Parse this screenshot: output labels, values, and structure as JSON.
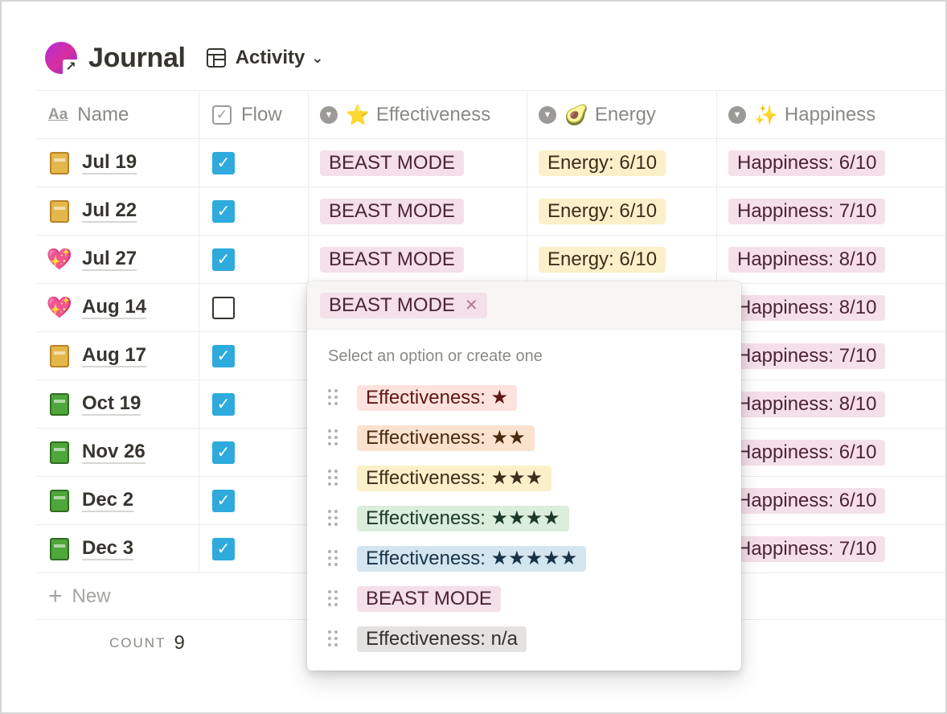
{
  "database": {
    "title": "Journal",
    "view_label": "Activity"
  },
  "columns": [
    {
      "label": "Name",
      "icon": "text-property-icon"
    },
    {
      "label": "Flow",
      "icon": "checkbox-property-icon"
    },
    {
      "label": "Effectiveness",
      "icon": "select-property-icon",
      "emoji": "⭐"
    },
    {
      "label": "Energy",
      "icon": "select-property-icon",
      "emoji": "🥑"
    },
    {
      "label": "Happiness",
      "icon": "select-property-icon",
      "emoji": "✨"
    }
  ],
  "rows": [
    {
      "name": "Jul 19",
      "page_icon": "yellow-notebook-icon",
      "flow": true,
      "effectiveness": "BEAST MODE",
      "energy": "Energy: 6/10",
      "happiness": "Happiness: 6/10"
    },
    {
      "name": "Jul 22",
      "page_icon": "yellow-notebook-icon",
      "flow": true,
      "effectiveness": "BEAST MODE",
      "energy": "Energy: 6/10",
      "happiness": "Happiness: 7/10"
    },
    {
      "name": "Jul 27",
      "page_icon": "sparkling-heart-icon",
      "flow": true,
      "effectiveness": "BEAST MODE",
      "energy": "Energy: 6/10",
      "happiness": "Happiness: 8/10"
    },
    {
      "name": "Aug 14",
      "page_icon": "sparkling-heart-icon",
      "flow": false,
      "effectiveness": "",
      "energy": "",
      "happiness": "Happiness: 8/10"
    },
    {
      "name": "Aug 17",
      "page_icon": "yellow-notebook-icon",
      "flow": true,
      "effectiveness": "",
      "energy": "",
      "happiness": "Happiness: 7/10"
    },
    {
      "name": "Oct 19",
      "page_icon": "green-book-icon",
      "flow": true,
      "effectiveness": "",
      "energy": "",
      "happiness": "Happiness: 8/10"
    },
    {
      "name": "Nov 26",
      "page_icon": "green-book-icon",
      "flow": true,
      "effectiveness": "",
      "energy": "",
      "happiness": "Happiness: 6/10"
    },
    {
      "name": "Dec 2",
      "page_icon": "green-book-icon",
      "flow": true,
      "effectiveness": "",
      "energy": "",
      "happiness": "Happiness: 6/10"
    },
    {
      "name": "Dec 3",
      "page_icon": "green-book-icon",
      "flow": true,
      "effectiveness": "",
      "energy": "",
      "happiness": "Happiness: 7/10"
    }
  ],
  "new_label": "New",
  "footer": {
    "count_label": "COUNT",
    "count_value": "9"
  },
  "popup": {
    "selected_tag": "BEAST MODE",
    "hint": "Select an option or create one",
    "options": [
      {
        "label": "Effectiveness: ★",
        "color": "#fde2dd"
      },
      {
        "label": "Effectiveness: ★★",
        "color": "#fbe2cf"
      },
      {
        "label": "Effectiveness: ★★★",
        "color": "#fbf0c9"
      },
      {
        "label": "Effectiveness: ★★★★",
        "color": "#dbeddb"
      },
      {
        "label": "Effectiveness: ★★★★★",
        "color": "#d3e5ef"
      },
      {
        "label": "BEAST MODE",
        "color": "#f5e0e9"
      },
      {
        "label": "Effectiveness: n/a",
        "color": "#e3e2e0"
      }
    ]
  },
  "colors": {
    "checkbox_checked": "#2eaadc",
    "tag_pink": "#f5e0e9",
    "tag_yellow": "#fbf0c9"
  }
}
